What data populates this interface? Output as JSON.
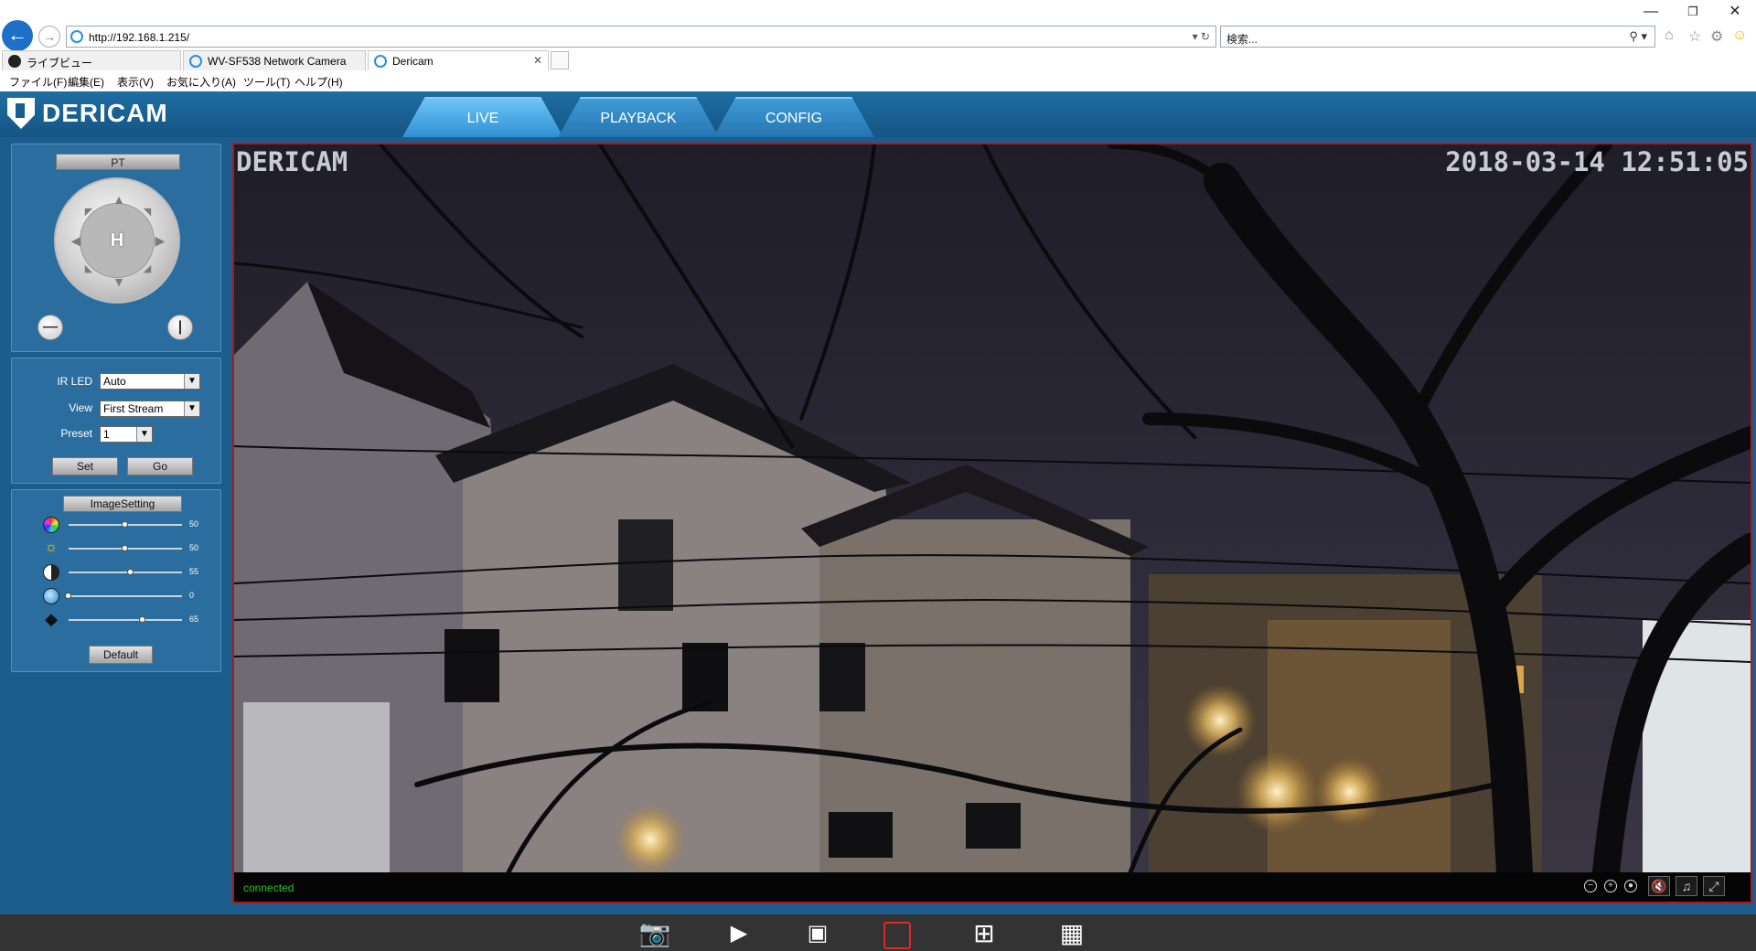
{
  "browser": {
    "url": "http://192.168.1.215/",
    "search_placeholder": "検索...",
    "tabs": [
      {
        "label": "ライブビュー"
      },
      {
        "label": "WV-SF538 Network Camera"
      },
      {
        "label": "Dericam"
      }
    ],
    "menu": [
      "ファイル(F)",
      "編集(E)",
      "表示(V)",
      "お気に入り(A)",
      "ツール(T)",
      "ヘルプ(H)"
    ]
  },
  "app": {
    "logo": "DERICAM",
    "tabs": [
      "LIVE",
      "PLAYBACK",
      "CONFIG"
    ],
    "active_tab": "LIVE",
    "pt": {
      "title": "PT",
      "home_label": "H"
    },
    "controls": {
      "ir_led_label": "IR LED",
      "ir_led_value": "Auto",
      "view_label": "View",
      "view_value": "First Stream",
      "preset_label": "Preset",
      "preset_value": "1",
      "set_label": "Set",
      "go_label": "Go"
    },
    "image_setting": {
      "title": "ImageSetting",
      "sliders": [
        {
          "icon": "color-saturation-icon",
          "value": 50
        },
        {
          "icon": "brightness-icon",
          "value": 50
        },
        {
          "icon": "contrast-icon",
          "value": 55
        },
        {
          "icon": "hue-icon",
          "value": 0
        },
        {
          "icon": "sharpness-icon",
          "value": 65
        }
      ],
      "default_label": "Default"
    },
    "video": {
      "osd_name": "DERICAM",
      "osd_timestamp": "2018-03-14  12:51:05",
      "status": "connected"
    }
  }
}
